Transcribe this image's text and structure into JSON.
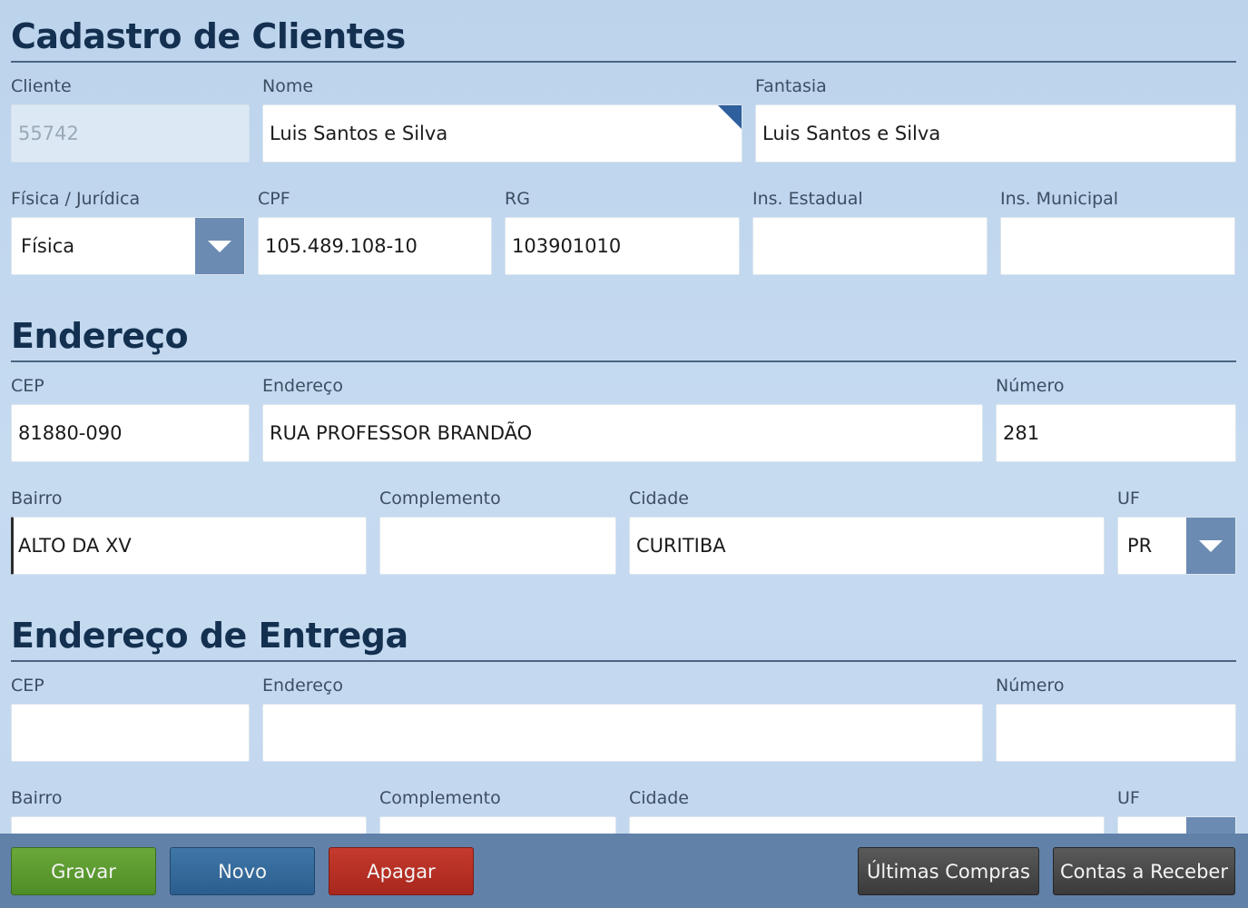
{
  "cadastro": {
    "title": "Cadastro de Clientes",
    "cliente": {
      "label": "Cliente",
      "value": "55742"
    },
    "nome": {
      "label": "Nome",
      "value": "Luis Santos e Silva"
    },
    "fantasia": {
      "label": "Fantasia",
      "value": "Luis Santos e Silva"
    },
    "tipo": {
      "label": "Física / Jurídica",
      "value": "Física"
    },
    "cpf": {
      "label": "CPF",
      "value": "105.489.108-10"
    },
    "rg": {
      "label": "RG",
      "value": "103901010"
    },
    "ins_estadual": {
      "label": "Ins. Estadual",
      "value": ""
    },
    "ins_municipal": {
      "label": "Ins. Municipal",
      "value": ""
    }
  },
  "endereco": {
    "title": "Endereço",
    "cep": {
      "label": "CEP",
      "value": "81880-090"
    },
    "endereco": {
      "label": "Endereço",
      "value": "RUA PROFESSOR BRANDÃO"
    },
    "numero": {
      "label": "Número",
      "value": "281"
    },
    "bairro": {
      "label": "Bairro",
      "value": "ALTO DA XV"
    },
    "complemento": {
      "label": "Complemento",
      "value": ""
    },
    "cidade": {
      "label": "Cidade",
      "value": "CURITIBA"
    },
    "uf": {
      "label": "UF",
      "value": "PR"
    }
  },
  "entrega": {
    "title": "Endereço de Entrega",
    "cep": {
      "label": "CEP",
      "value": ""
    },
    "endereco": {
      "label": "Endereço",
      "value": ""
    },
    "numero": {
      "label": "Número",
      "value": ""
    },
    "bairro": {
      "label": "Bairro",
      "value": ""
    },
    "complemento": {
      "label": "Complemento",
      "value": ""
    },
    "cidade": {
      "label": "Cidade",
      "value": ""
    },
    "uf": {
      "label": "UF",
      "value": ""
    }
  },
  "actions": {
    "gravar": "Gravar",
    "novo": "Novo",
    "apagar": "Apagar",
    "ultimas_compras": "Últimas Compras",
    "contas_receber": "Contas a Receber"
  },
  "icons": {
    "dropdown": "chevron-down-icon",
    "required_marker": "corner-marker-icon"
  },
  "colors": {
    "section_title": "#143050",
    "select_arrow_bg": "#6b8bb3",
    "bottom_bar": "#6181a9",
    "btn_green": "#4f8d27",
    "btn_blue": "#2b5e8e",
    "btn_red": "#a8271d",
    "btn_dark": "#3a3a3a"
  }
}
